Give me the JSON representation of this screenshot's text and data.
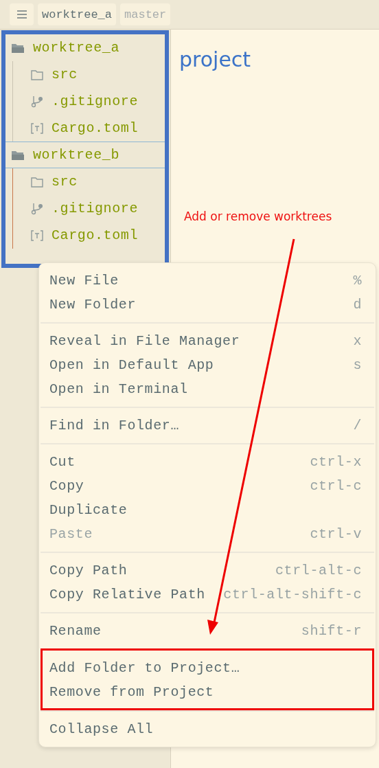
{
  "toolbar": {
    "tabs": [
      {
        "label": "worktree_a",
        "dimmed": false
      },
      {
        "label": "master",
        "dimmed": true
      }
    ]
  },
  "project_panel": {
    "highlighted": true,
    "worktrees": [
      {
        "name": "worktree_a",
        "selected": false,
        "children": [
          {
            "name": "src",
            "kind": "folder"
          },
          {
            "name": ".gitignore",
            "kind": "git"
          },
          {
            "name": "Cargo.toml",
            "kind": "toml"
          }
        ]
      },
      {
        "name": "worktree_b",
        "selected": true,
        "children": [
          {
            "name": "src",
            "kind": "folder"
          },
          {
            "name": ".gitignore",
            "kind": "git"
          },
          {
            "name": "Cargo.toml",
            "kind": "toml"
          }
        ]
      }
    ]
  },
  "editor": {
    "title": "project"
  },
  "annotation": {
    "text": "Add or remove worktrees"
  },
  "context_menu": {
    "groups": [
      {
        "highlighted": false,
        "items": [
          {
            "label": "New File",
            "shortcut": "%",
            "disabled": false
          },
          {
            "label": "New Folder",
            "shortcut": "d",
            "disabled": false
          }
        ]
      },
      {
        "highlighted": false,
        "items": [
          {
            "label": "Reveal in File Manager",
            "shortcut": "x",
            "disabled": false
          },
          {
            "label": "Open in Default App",
            "shortcut": "s",
            "disabled": false
          },
          {
            "label": "Open in Terminal",
            "disabled": false
          }
        ]
      },
      {
        "highlighted": false,
        "items": [
          {
            "label": "Find in Folder…",
            "shortcut": "/",
            "disabled": false
          }
        ]
      },
      {
        "highlighted": false,
        "items": [
          {
            "label": "Cut",
            "shortcut": "ctrl-x",
            "disabled": false
          },
          {
            "label": "Copy",
            "shortcut": "ctrl-c",
            "disabled": false
          },
          {
            "label": "Duplicate",
            "disabled": false
          },
          {
            "label": "Paste",
            "shortcut": "ctrl-v",
            "disabled": true
          }
        ]
      },
      {
        "highlighted": false,
        "items": [
          {
            "label": "Copy Path",
            "shortcut": "ctrl-alt-c",
            "disabled": false
          },
          {
            "label": "Copy Relative Path",
            "shortcut": "ctrl-alt-shift-c",
            "disabled": false
          }
        ]
      },
      {
        "highlighted": false,
        "items": [
          {
            "label": "Rename",
            "shortcut": "shift-r",
            "disabled": false
          }
        ]
      },
      {
        "highlighted": true,
        "items": [
          {
            "label": "Add Folder to Project…",
            "disabled": false
          },
          {
            "label": "Remove from Project",
            "disabled": false
          }
        ]
      },
      {
        "highlighted": false,
        "items": [
          {
            "label": "Collapse All",
            "disabled": false
          }
        ]
      }
    ]
  }
}
